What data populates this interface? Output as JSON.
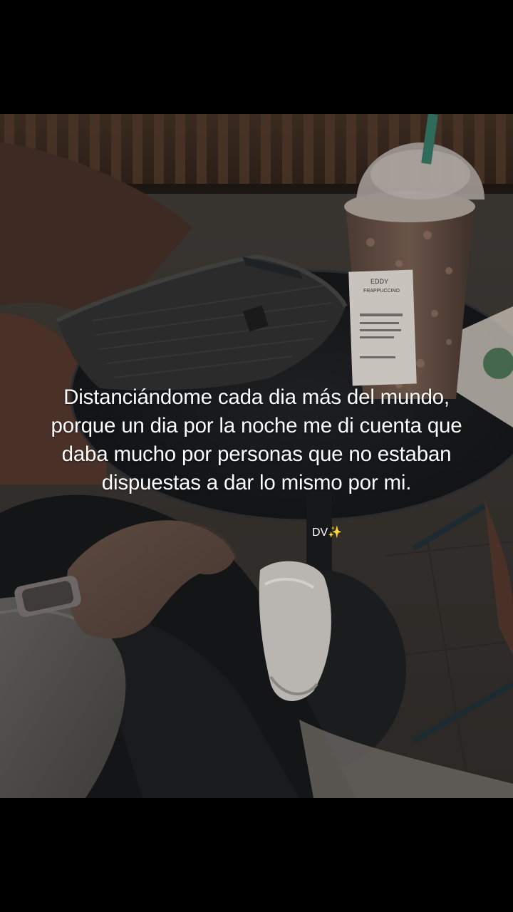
{
  "caption": {
    "text": "Distanciándome cada dia más del mundo, porque un dia por la noche me di cuenta que daba mucho por personas que no estaban dispuestas a dar lo mismo por mi."
  },
  "signature": {
    "text": "DV",
    "emoji": "✨"
  },
  "cup_label": {
    "line1": "EDDY",
    "line2": "FRAPPUCCINO"
  }
}
